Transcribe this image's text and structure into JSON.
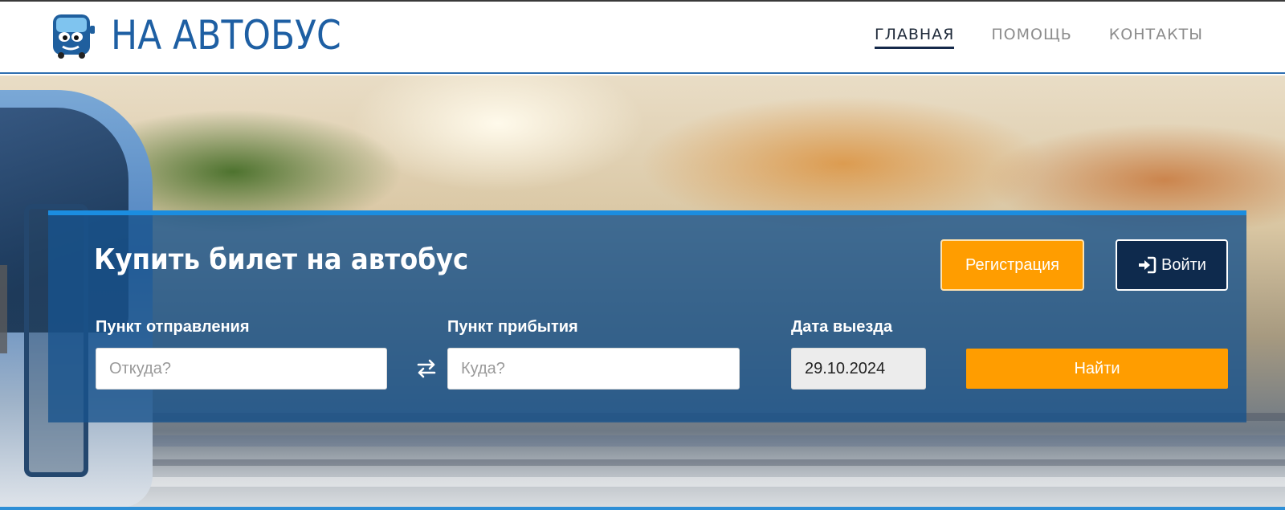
{
  "header": {
    "logo_text": "НА АВТОБУС",
    "logo_icon": "bus-mascot-icon",
    "nav": [
      {
        "label": "ГЛАВНАЯ",
        "active": true
      },
      {
        "label": "ПОМОЩЬ",
        "active": false
      },
      {
        "label": "КОНТАКТЫ",
        "active": false
      }
    ]
  },
  "search_panel": {
    "title": "Купить билет на автобус",
    "register_label": "Регистрация",
    "login_label": "Войти",
    "login_icon": "sign-in-icon",
    "departure": {
      "label": "Пункт отправления",
      "placeholder": "Откуда?",
      "value": ""
    },
    "swap_icon": "swap-arrows-icon",
    "arrival": {
      "label": "Пункт прибытия",
      "placeholder": "Куда?",
      "value": ""
    },
    "date": {
      "label": "Дата выезда",
      "value": "29.10.2024"
    },
    "search_label": "Найти"
  },
  "colors": {
    "brand_blue": "#1e5fa3",
    "accent_orange": "#ff9d00",
    "login_navy": "#0e2a4d",
    "panel_top_border": "#1b8de0"
  }
}
